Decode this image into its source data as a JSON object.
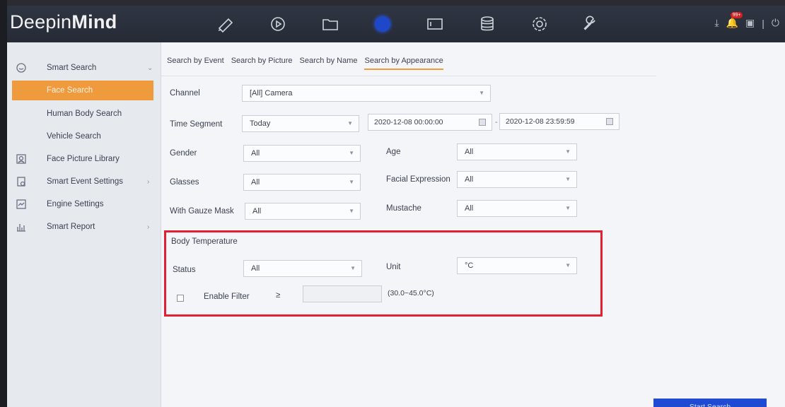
{
  "app": {
    "logo_light": "Deepin",
    "logo_bold": "Mind"
  },
  "topbar": {
    "nav_icons": [
      "live-view-camera-icon",
      "playback-icon",
      "file-management-icon",
      "smart-search-icon",
      "display-icon",
      "storage-icon",
      "settings-gear-icon",
      "maintenance-wrench-icon"
    ],
    "notification_badge": "99+",
    "accent_color": "#1e48c8"
  },
  "sidebar": {
    "items": [
      {
        "label": "Smart Search",
        "icon": "smart-search-icon"
      },
      {
        "label": "Face Search"
      },
      {
        "label": "Human Body Search"
      },
      {
        "label": "Vehicle Search"
      },
      {
        "label": "Face Picture Library",
        "icon": "face-library-icon"
      },
      {
        "label": "Smart Event Settings",
        "icon": "event-settings-icon"
      },
      {
        "label": "Engine Settings",
        "icon": "engine-settings-icon"
      },
      {
        "label": "Smart Report",
        "icon": "report-chart-icon"
      }
    ],
    "active_color": "#f09a3e"
  },
  "tabs": [
    "Search by Event",
    "Search by Picture",
    "Search by Name",
    "Search by Appearance"
  ],
  "form": {
    "channel_label": "Channel",
    "channel_value": "[All] Camera",
    "time_segment_label": "Time Segment",
    "time_segment_value": "Today",
    "start_time": "2020-12-08 00:00:00",
    "end_time": "2020-12-08 23:59:59",
    "range_dash": "-",
    "gender_label": "Gender",
    "gender_value": "All",
    "age_label": "Age",
    "age_value": "All",
    "glasses_label": "Glasses",
    "glasses_value": "All",
    "expression_label": "Facial Expression",
    "expression_value": "All",
    "mask_label": "With Gauze Mask",
    "mask_value": "All",
    "mustache_label": "Mustache",
    "mustache_value": "All"
  },
  "body_temp": {
    "title": "Body Temperature",
    "status_label": "Status",
    "status_value": "All",
    "unit_label": "Unit",
    "unit_value": "°C",
    "enable_filter_label": "Enable Filter",
    "gte_symbol": "≥",
    "threshold_value": "",
    "range_hint": "(30.0~45.0°C)",
    "highlight_color": "#e12031"
  },
  "actions": {
    "start_search": "Start Search"
  }
}
